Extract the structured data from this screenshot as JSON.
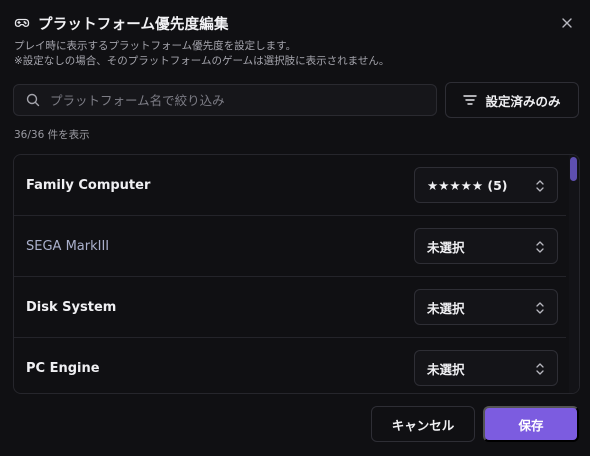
{
  "dialog": {
    "title": "プラットフォーム優先度編集",
    "description_line1": "プレイ時に表示するプラットフォーム優先度を設定します。",
    "description_line2": "※設定なしの場合、そのプラットフォームのゲームは選択肢に表示されません。"
  },
  "search": {
    "placeholder": "プラットフォーム名で絞り込み",
    "value": ""
  },
  "filter": {
    "label": "設定済みのみ"
  },
  "count_text": "36/36 件を表示",
  "platforms": [
    {
      "name": "Family Computer",
      "priority": "★★★★★ (5)"
    },
    {
      "name": "SEGA MarkIII",
      "priority": "未選択"
    },
    {
      "name": "Disk System",
      "priority": "未選択"
    },
    {
      "name": "PC Engine",
      "priority": "未選択"
    }
  ],
  "footer": {
    "cancel_label": "キャンセル",
    "save_label": "保存"
  },
  "colors": {
    "accent": "#7c5ce0",
    "background": "#101013",
    "border": "#2e2e35",
    "muted_text": "#aab0cc"
  },
  "icons": [
    "gamepad-icon",
    "close-icon",
    "search-icon",
    "filter-icon",
    "chevron-up-down-icon"
  ]
}
